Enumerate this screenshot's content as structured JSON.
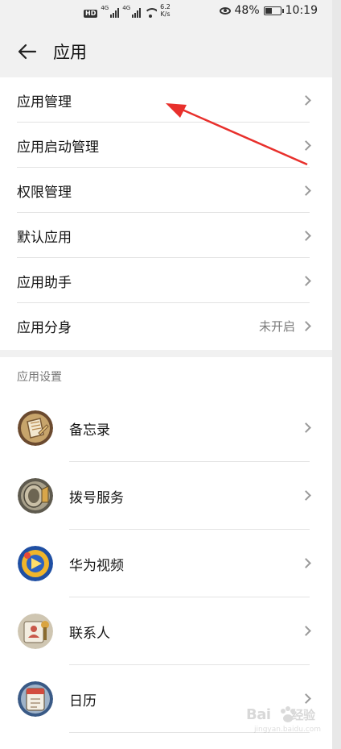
{
  "status_bar": {
    "hd": "HD",
    "network_1": "4G",
    "network_2": "4G",
    "speed_value": "6.2",
    "speed_unit": "K/s",
    "battery": "48%",
    "time": "10:19"
  },
  "header": {
    "title": "应用"
  },
  "menu": [
    {
      "label": "应用管理",
      "value": ""
    },
    {
      "label": "应用启动管理",
      "value": ""
    },
    {
      "label": "权限管理",
      "value": ""
    },
    {
      "label": "默认应用",
      "value": ""
    },
    {
      "label": "应用助手",
      "value": ""
    },
    {
      "label": "应用分身",
      "value": "未开启"
    }
  ],
  "app_settings": {
    "section_title": "应用设置",
    "apps": [
      {
        "label": "备忘录",
        "icon": "memo-icon"
      },
      {
        "label": "拨号服务",
        "icon": "dialer-icon"
      },
      {
        "label": "华为视频",
        "icon": "video-icon"
      },
      {
        "label": "联系人",
        "icon": "contacts-icon"
      },
      {
        "label": "日历",
        "icon": "calendar-icon"
      }
    ]
  },
  "watermark": {
    "text": "Bai",
    "text2": "经验",
    "sub": "jingyan.baidu.com"
  },
  "colors": {
    "arrow": "#e8302c",
    "accent_chevron": "#9a9a9a"
  }
}
